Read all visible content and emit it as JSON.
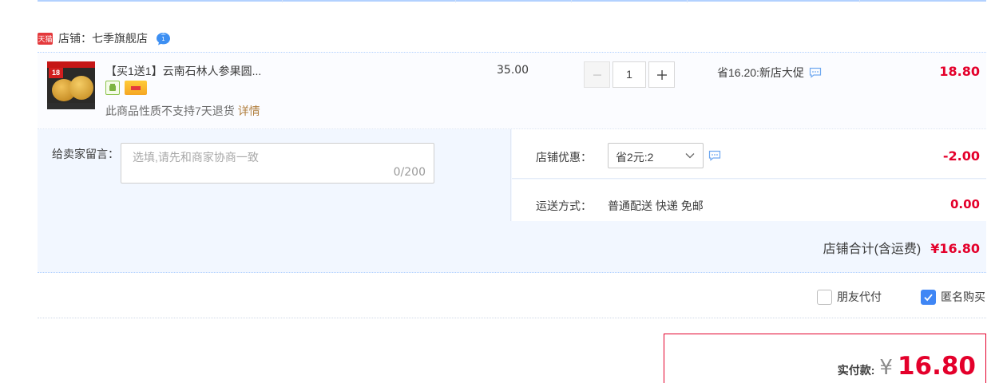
{
  "shop": {
    "badge": "天猫",
    "label": "店铺：",
    "name": "七季旗舰店"
  },
  "item": {
    "title": "【买1送1】云南石林人参果圆...",
    "notice": "此商品性质不支持7天退货",
    "notice_link": "详情",
    "unit_price": "35.00",
    "quantity": "1",
    "promotion": "省16.20:新店大促",
    "total": "18.80",
    "thumb_price": "18"
  },
  "message": {
    "label": "给卖家留言：",
    "placeholder": "选填,请先和商家协商一致",
    "counter": "0/200"
  },
  "coupon": {
    "label": "店铺优惠：",
    "selected": "省2元:2",
    "amount": "-2.00"
  },
  "shipping": {
    "label": "运送方式：",
    "value": "普通配送 快递 免邮",
    "amount": "0.00"
  },
  "shop_total": {
    "label": "店铺合计(含运费)",
    "amount": "¥16.80"
  },
  "options": {
    "friend_pay": {
      "label": "朋友代付",
      "checked": false
    },
    "anonymous": {
      "label": "匿名购买",
      "checked": true
    }
  },
  "payment": {
    "label": "实付款:",
    "currency": "¥",
    "amount": "16.80"
  },
  "colors": {
    "price_red": "#e4002b",
    "accent_blue": "#3f86f5",
    "link_brown": "#b17f3f",
    "row_bg": "#f2f7ff"
  }
}
